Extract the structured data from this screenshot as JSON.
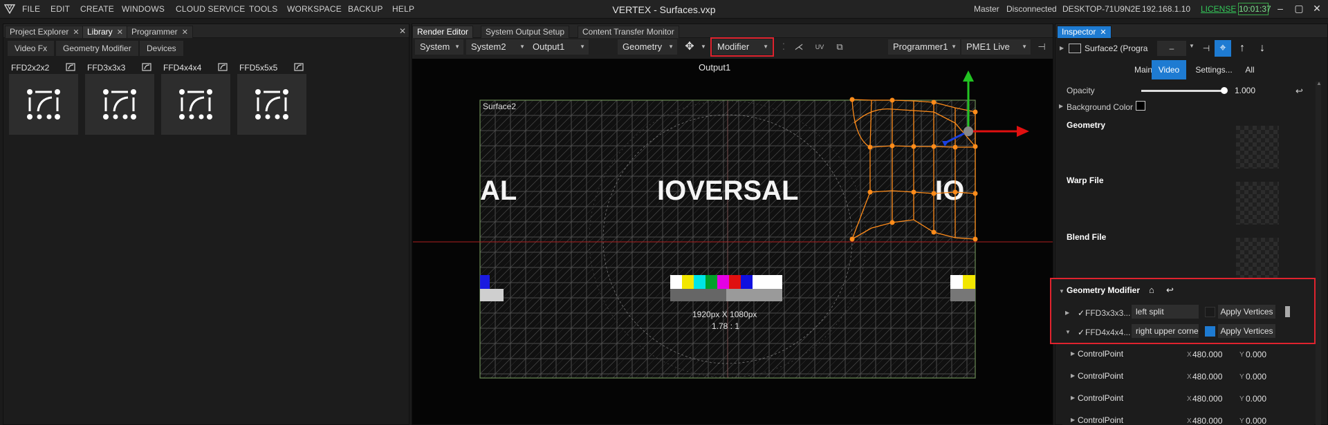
{
  "menu": {
    "items": [
      "FILE",
      "EDIT",
      "CREATE",
      "WINDOWS",
      "CLOUD SERVICE",
      "TOOLS",
      "WORKSPACE",
      "BACKUP",
      "HELP"
    ],
    "title": "VERTEX - Surfaces.vxp",
    "status": [
      "Master",
      "Disconnected",
      "DESKTOP-71U9N2E",
      "192.168.1.10"
    ],
    "license": "LICENSE",
    "clock": "10:01:37"
  },
  "left_panel": {
    "tabs": [
      "Project Explorer",
      "Library",
      "Programmer"
    ],
    "subtabs": [
      "Video Fx",
      "Geometry Modifier",
      "Devices"
    ],
    "items": [
      "FFD2x2x2",
      "FFD3x3x3",
      "FFD4x4x4",
      "FFD5x5x5"
    ]
  },
  "center_panel": {
    "tabs": [
      "Render Editor",
      "System Output Setup",
      "Content Transfer Monitor"
    ],
    "toolbar": {
      "system": "System",
      "system2": "System2",
      "output": "Output1",
      "view": "Geometry",
      "mode": "Modifier",
      "programmer": "Programmer1",
      "live": "PME1 Live"
    },
    "viewport": {
      "output_label": "Output1",
      "surface_label": "Surface2",
      "logo_text": "IOVERSAL",
      "logo_left": "AL",
      "logo_right": "IO",
      "resolution": "1920px X 1080px",
      "ratio": "1.78 : 1"
    }
  },
  "inspector": {
    "tab": "Inspector",
    "surface": "Surface2 (Progra",
    "tabs": [
      "Main",
      "Video",
      "Settings...",
      "All"
    ],
    "opacity_label": "Opacity",
    "opacity_value": "1.000",
    "opacity_level": 1.0,
    "bg_color_label": "Background Color",
    "geometry_label": "Geometry",
    "warp_label": "Warp File",
    "blend_label": "Blend File",
    "geometry_modifier": {
      "title": "Geometry Modifier",
      "rows": [
        {
          "name": "FFD3x3x3...",
          "field": "left split",
          "button": "Apply Vertices"
        },
        {
          "name": "FFD4x4x4...",
          "field": "right upper corne",
          "button": "Apply Vertices"
        }
      ]
    },
    "control_points": [
      {
        "label": "ControlPoint",
        "x_label": "X",
        "x": "480.000",
        "y_label": "Y",
        "y": "0.000"
      },
      {
        "label": "ControlPoint",
        "x_label": "X",
        "x": "480.000",
        "y_label": "Y",
        "y": "0.000"
      },
      {
        "label": "ControlPoint",
        "x_label": "X",
        "x": "480.000",
        "y_label": "Y",
        "y": "0.000"
      },
      {
        "label": "ControlPoint",
        "x_label": "X",
        "x": "480.000",
        "y_label": "Y",
        "y": "0.000"
      }
    ]
  },
  "colors": {
    "accent": "#1e7bd2",
    "highlight": "#e0232e",
    "license": "#34c759",
    "gizmo_orange": "#ff8c1a"
  }
}
